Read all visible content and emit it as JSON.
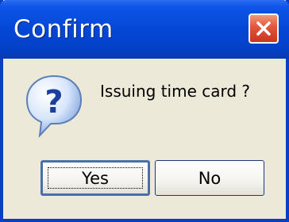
{
  "window": {
    "title": "Confirm",
    "colors": {
      "titlebar": "#0447d6",
      "close": "#e0553c",
      "body": "#ece9d8"
    }
  },
  "close_icon": "close-icon",
  "dialog_icon": "question-icon",
  "message": "Issuing time card ?",
  "buttons": {
    "yes_label": "Yes",
    "no_label": "No"
  }
}
